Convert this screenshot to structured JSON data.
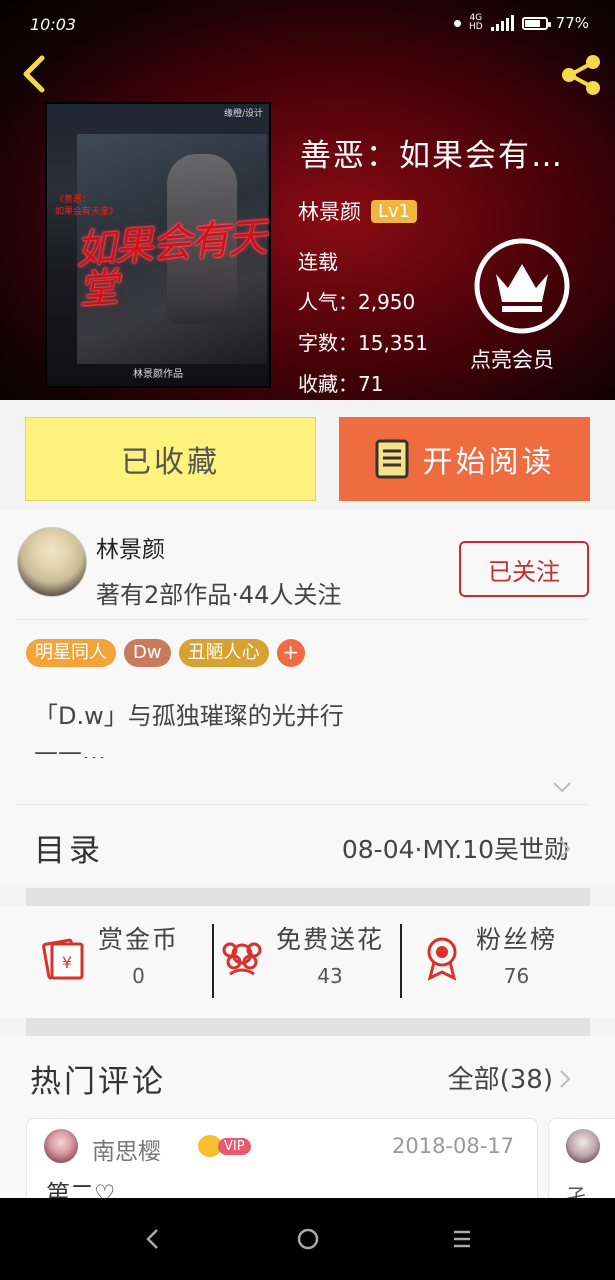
{
  "status_bar": {
    "time": "10:03",
    "network": "4G",
    "hd": "HD",
    "battery": "77%"
  },
  "header": {
    "back_icon": "chevron-left-icon",
    "share_icon": "share-icon"
  },
  "cover": {
    "credit": "缘橙/设计",
    "subtitle_line1": "《善恶：",
    "subtitle_line2": "如果会有天堂》",
    "title": "如果会有天堂",
    "tag": "<善恶>",
    "author": "林景颜作品"
  },
  "book": {
    "title": "善恶：如果会有…",
    "author": "林景颜",
    "level": "Lv1",
    "status": "连载",
    "popularity": "人气：2,950",
    "word_count": "字数：15,351",
    "collections": "收藏：71",
    "vip_label": "点亮会员"
  },
  "actions": {
    "collected_label": "已收藏",
    "read_label": "开始阅读"
  },
  "author_card": {
    "name": "林景颜",
    "stats": "著有2部作品·44人关注",
    "follow_label": "已关注"
  },
  "tags": [
    {
      "label": "明星同人",
      "color": "#f2a33a"
    },
    {
      "label": "Dw",
      "color": "#c97a5c"
    },
    {
      "label": "丑陋人心",
      "color": "#d8a233"
    }
  ],
  "tag_add_label": "+",
  "intro": {
    "line1": "「D.w」与孤独璀璨的光并行",
    "line2": "——…"
  },
  "toc": {
    "label": "目录",
    "latest": "08-04·MY.10吴世勋"
  },
  "stats": [
    {
      "label": "赏金币",
      "value": "0",
      "icon": "red-envelope-icon"
    },
    {
      "label": "免费送花",
      "value": "43",
      "icon": "flower-icon"
    },
    {
      "label": "粉丝榜",
      "value": "76",
      "icon": "medal-icon"
    }
  ],
  "comments": {
    "heading": "热门评论",
    "all_label": "全部(38)",
    "items": [
      {
        "user": "南思樱",
        "vip": "VIP",
        "date": "2018-08-17",
        "text": "第二♡"
      },
      {
        "text": "孑"
      }
    ]
  },
  "nav": {
    "back": "back-triangle-icon",
    "home": "home-circle-icon",
    "menu": "menu-lines-icon"
  }
}
